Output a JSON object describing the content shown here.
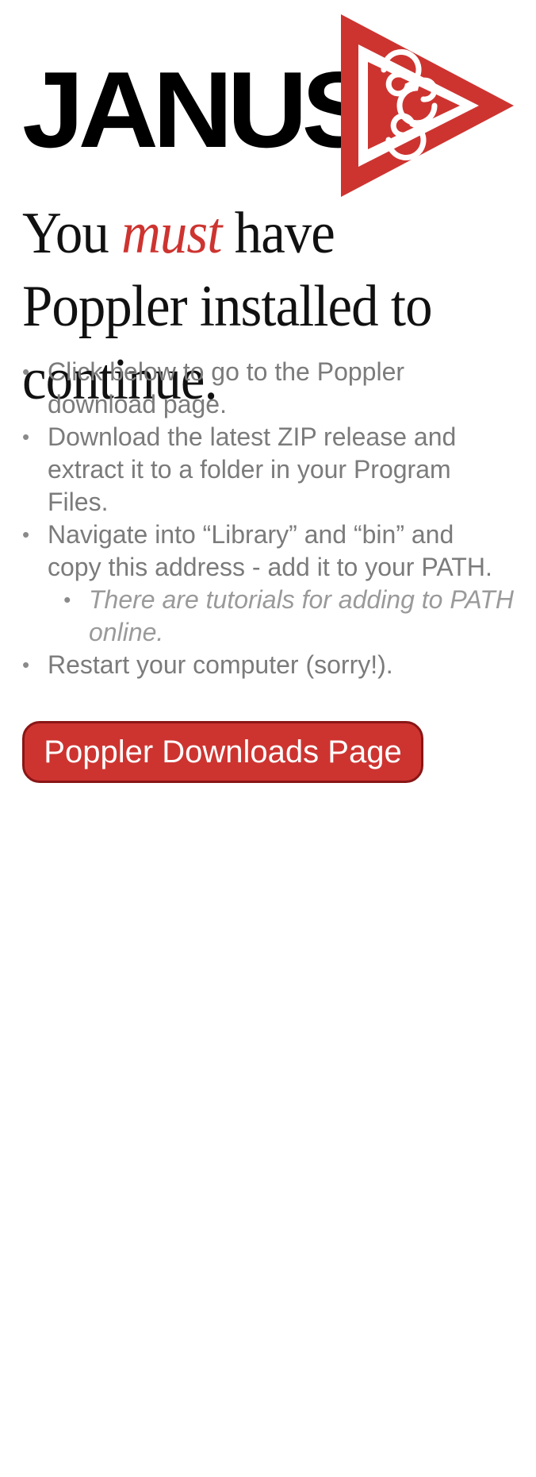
{
  "brand": {
    "name": "JANUS",
    "accent_color": "#cd3430",
    "mark_icon": "triskelion-triangle-icon"
  },
  "headline": {
    "before": "You ",
    "emphasis": "must",
    "after": " have Poppler installed to continue."
  },
  "steps": [
    "Click below to go to the Poppler download page.",
    "Download the latest ZIP release and extract it to a folder in your Program Files.",
    "Navigate into “Library” and “bin” and copy this address - add it to your PATH.",
    "Restart your computer (sorry!)."
  ],
  "substep": "There are tutorials for adding to PATH online.",
  "button": {
    "label": "Poppler Downloads Page",
    "color": "#cd3430",
    "border_color": "#8a1616"
  }
}
